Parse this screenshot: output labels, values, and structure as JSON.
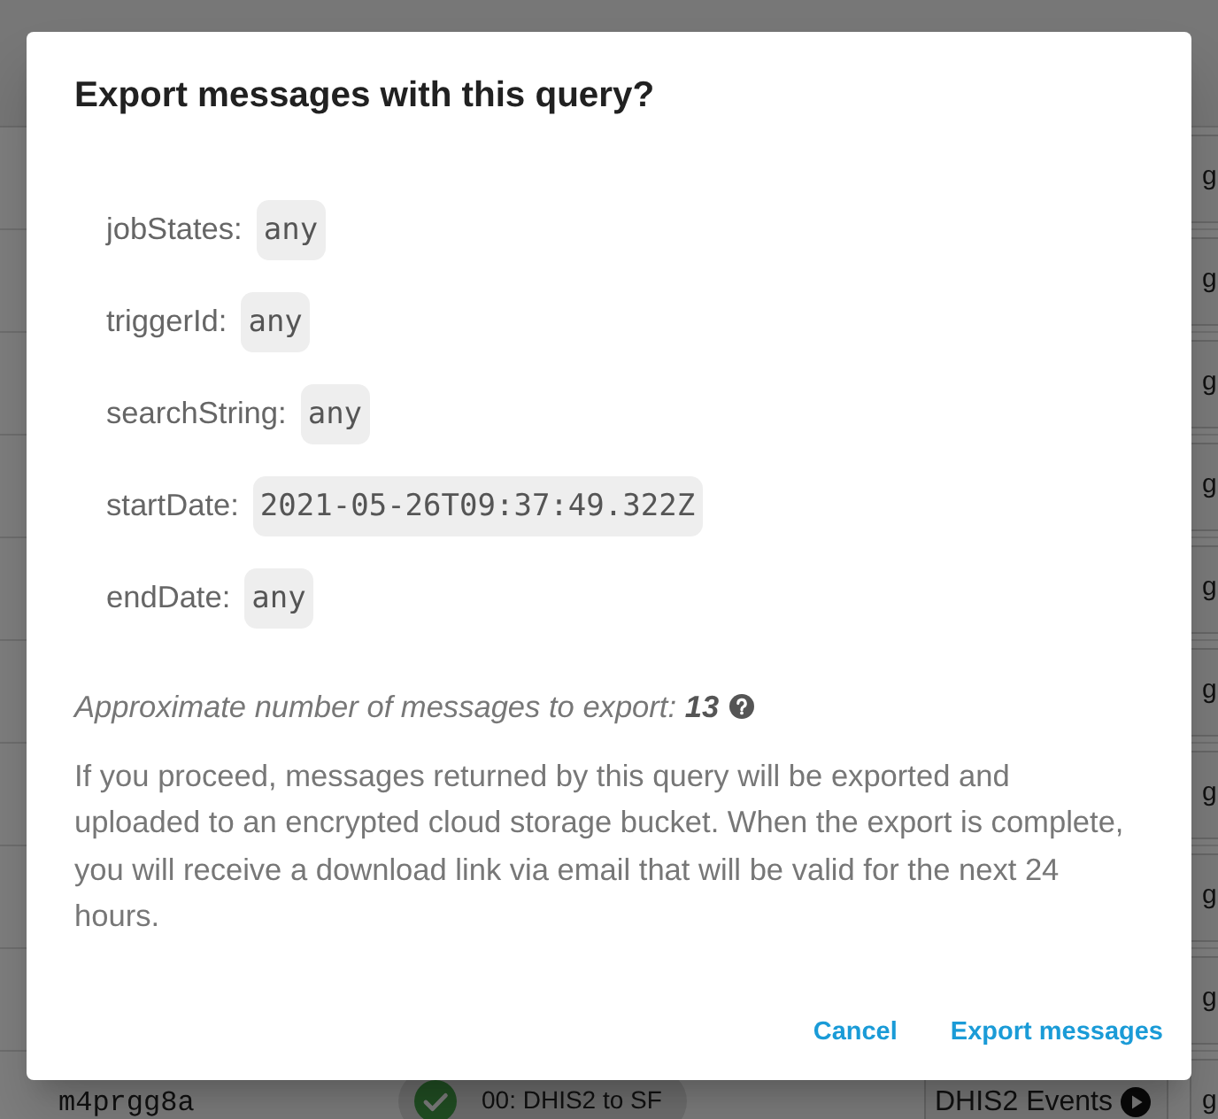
{
  "background_table": {
    "rows": [
      {
        "column_4": "g"
      },
      {
        "column_4": "g"
      },
      {
        "column_4": "g"
      },
      {
        "column_4": "g"
      },
      {
        "column_4": "g"
      },
      {
        "column_4": "g"
      },
      {
        "column_4": "g"
      },
      {
        "column_4": "g"
      },
      {
        "column_4": "g"
      },
      {
        "column_1": "m4prgg8a",
        "column_2": "00: DHIS2 to SF",
        "column_3": "DHIS2 Events",
        "column_4": "g"
      }
    ]
  },
  "dialog": {
    "title": "Export messages with this query?",
    "query": [
      {
        "label": "jobStates:",
        "value": "any"
      },
      {
        "label": "triggerId:",
        "value": "any"
      },
      {
        "label": "searchString:",
        "value": "any"
      },
      {
        "label": "startDate:",
        "value": "2021-05-26T09:37:49.322Z"
      },
      {
        "label": "endDate:",
        "value": "any"
      }
    ],
    "estimate": "Approximate number of messages to export: **13**",
    "description": "If you proceed, messages returned by this query will be exported and uploaded to an encrypted cloud storage bucket. When the export is complete, you will receive a download link via email that will be valid for the next 24 hours.",
    "buttons": [
      "Cancel",
      "Export messages"
    ]
  }
}
